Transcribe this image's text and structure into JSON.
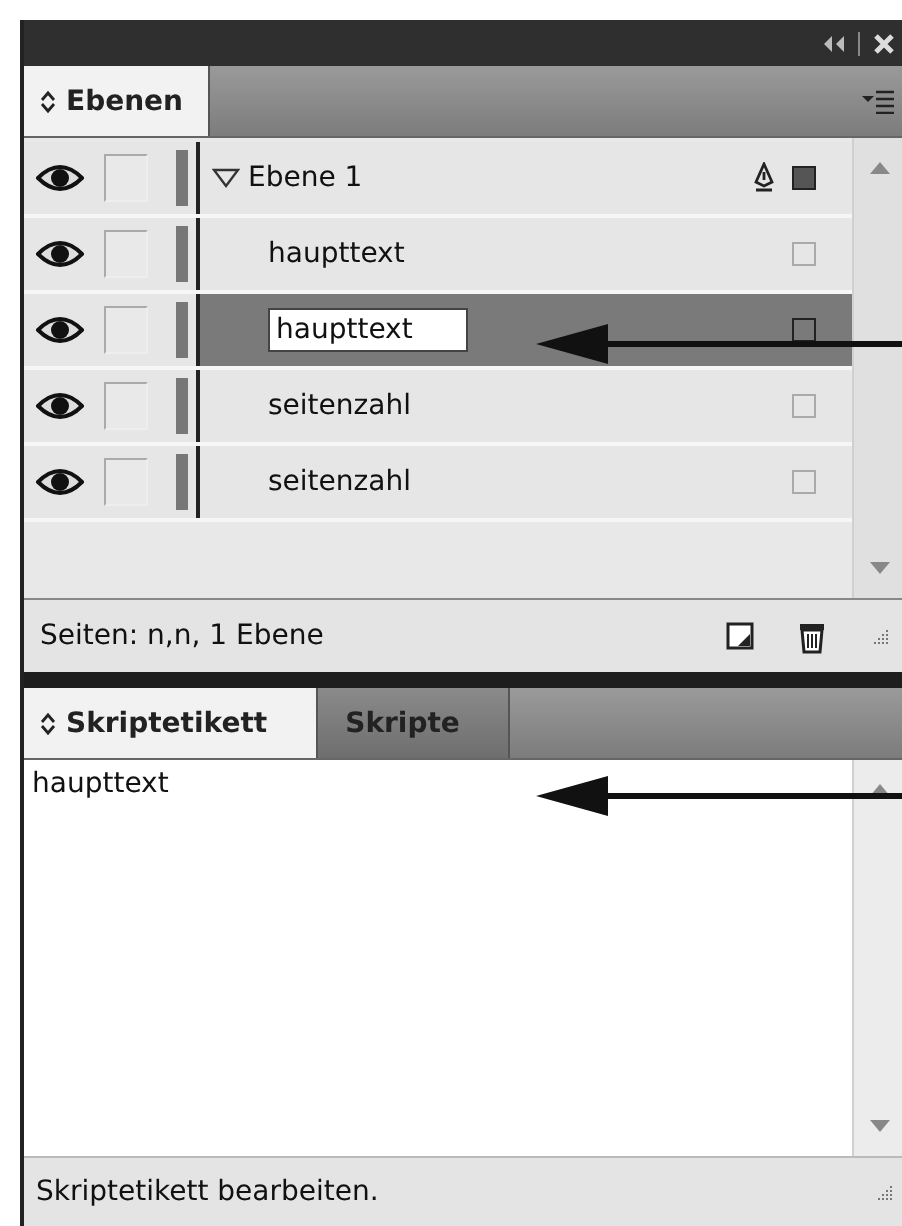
{
  "layers_panel": {
    "tabs": [
      {
        "label": "Ebenen",
        "selected": true
      }
    ],
    "layers": [
      {
        "name": "Ebene 1",
        "expanded": true,
        "visible": true,
        "children": [
          {
            "name": "haupttext",
            "visible": true,
            "selected": false,
            "editing": false
          },
          {
            "name": "haupttext",
            "visible": true,
            "selected": true,
            "editing": true
          },
          {
            "name": "seitenzahl",
            "visible": true,
            "selected": false,
            "editing": false
          },
          {
            "name": "seitenzahl",
            "visible": true,
            "selected": false,
            "editing": false
          }
        ]
      }
    ],
    "footer": "Seiten: n,n, 1 Ebene"
  },
  "script_panel": {
    "tabs": [
      {
        "label": "Skriptetikett",
        "selected": true
      },
      {
        "label": "Skripte",
        "selected": false
      }
    ],
    "label_text": "haupttext",
    "status": "Skriptetikett bearbeiten."
  }
}
